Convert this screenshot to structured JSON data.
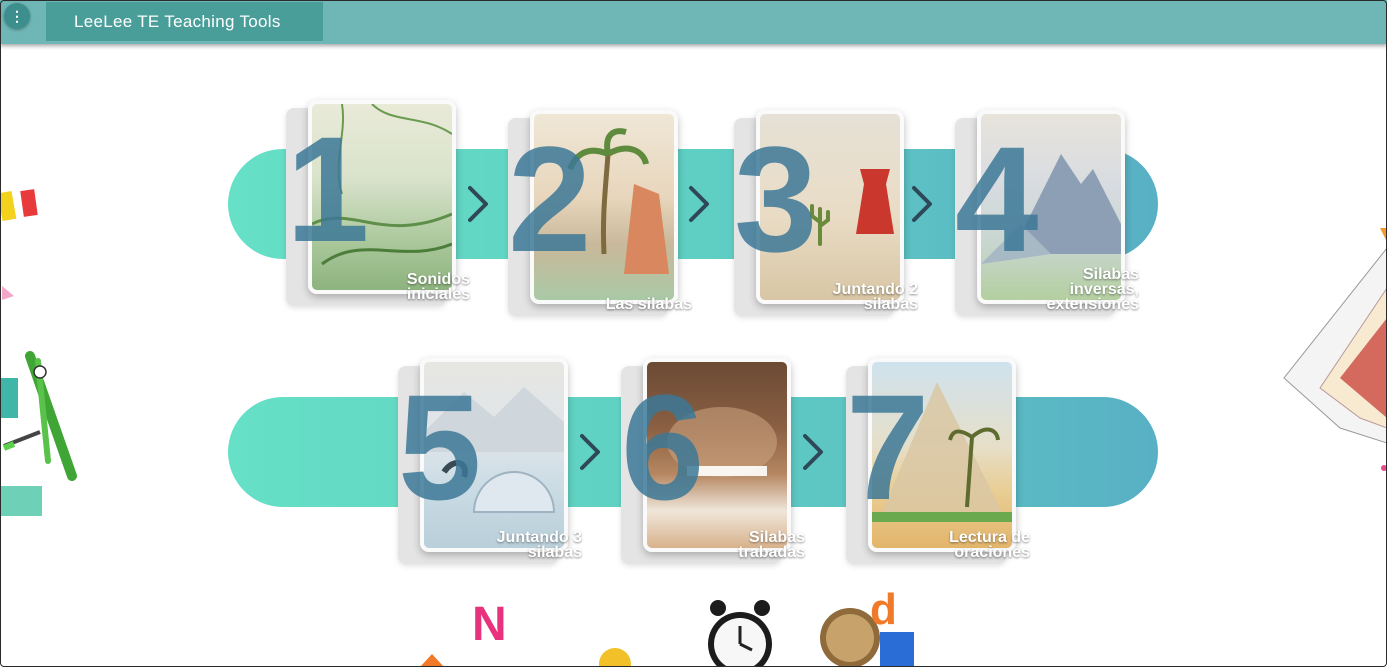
{
  "app": {
    "menu_icon": "⋮",
    "title": "LeeLee TE Teaching Tools"
  },
  "row1": [
    {
      "number": "1",
      "label": "Sonidos iniciales"
    },
    {
      "number": "2",
      "label": "Las silabas"
    },
    {
      "number": "3",
      "label": "Juntando 2 silabas"
    },
    {
      "number": "4",
      "label": "Silabas inversas, extensiones"
    }
  ],
  "row2": [
    {
      "number": "5",
      "label": "Juntando 3 silabas"
    },
    {
      "number": "6",
      "label": "Silabas trabadas"
    },
    {
      "number": "7",
      "label": "Lectura de oraciones"
    }
  ],
  "colors": {
    "topbar": "#6fb7b6",
    "track_left": "#66e0c6",
    "track_right": "#58b0c4",
    "number": "#3c7896"
  },
  "icons": {
    "menu": "more-vertical-icon",
    "arrow": "chevron-right-icon"
  }
}
